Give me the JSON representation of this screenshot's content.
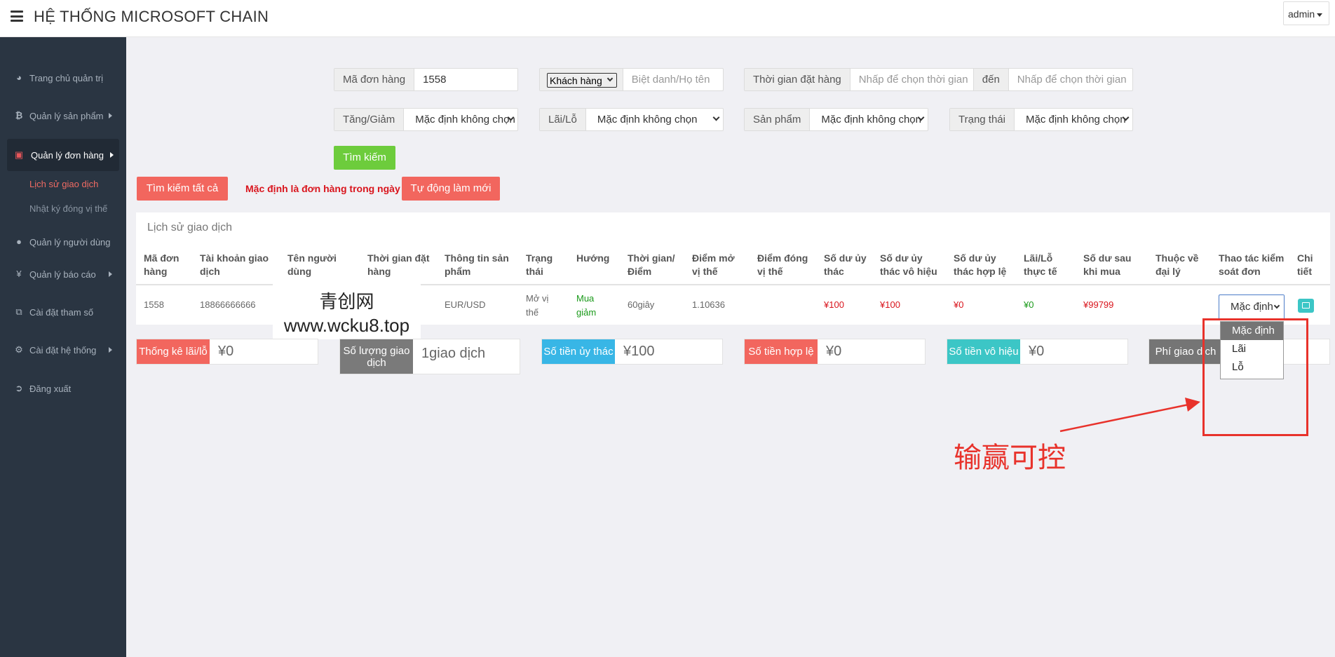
{
  "header": {
    "title": "HỆ THỐNG MICROSOFT CHAIN",
    "user": "admin"
  },
  "sidebar": {
    "items": [
      {
        "label": "Trang chủ quản trị",
        "icon": "dashboard-icon"
      },
      {
        "label": "Quản lý sản phẩm",
        "icon": "bitcoin-icon"
      },
      {
        "label": "Quản lý đơn hàng",
        "icon": "orders-icon"
      },
      {
        "label": "Quản lý người dùng",
        "icon": "user-icon"
      },
      {
        "label": "Quản lý báo cáo",
        "icon": "yen-icon"
      },
      {
        "label": "Cài đặt tham số",
        "icon": "copy-icon"
      },
      {
        "label": "Cài đặt hệ thống",
        "icon": "gears-icon"
      },
      {
        "label": "Đăng xuất",
        "icon": "logout-icon"
      }
    ],
    "sub_items": [
      {
        "label": "Lịch sử giao dịch"
      },
      {
        "label": "Nhật ký đóng vị thế"
      }
    ]
  },
  "filters": {
    "order_id": {
      "label": "Mã đơn hàng",
      "value": "1558"
    },
    "customer": {
      "select": "Khách hàng",
      "placeholder": "Biệt danh/Họ tên"
    },
    "order_time": {
      "label": "Thời gian đặt hàng",
      "placeholder_from": "Nhấp để chọn thời gian",
      "to_label": "đến",
      "placeholder_to": "Nhấp để chọn thời gian"
    },
    "direction": {
      "label": "Tăng/Giảm",
      "value": "Mặc định không chọn"
    },
    "profit": {
      "label": "Lãi/Lỗ",
      "value": "Mặc định không chọn"
    },
    "product": {
      "label": "Sản phẩm",
      "value": "Mặc định không chọn"
    },
    "status": {
      "label": "Trạng thái",
      "value": "Mặc định không chọn"
    },
    "search_button": "Tìm kiếm"
  },
  "actions": {
    "search_all": "Tìm kiếm tất cả",
    "default_note": "Mặc định là đơn hàng trong ngày",
    "auto_refresh": "Tự động làm mới"
  },
  "table": {
    "title": "Lịch sử giao dịch",
    "columns": [
      "Mã đơn hàng",
      "Tài khoản giao dịch",
      "Tên người dùng",
      "Thời gian đặt hàng",
      "Thông tin sản phẩm",
      "Trạng thái",
      "Hướng",
      "Thời gian/ Điểm",
      "Điểm mở vị thế",
      "Điểm đóng vị thế",
      "Số dư ủy thác",
      "Số dư ủy thác vô hiệu",
      "Số dư ủy thác hợp lệ",
      "Lãi/Lỗ thực tế",
      "Số dư sau khi mua",
      "Thuộc về đại lý",
      "Thao tác kiểm soát đơn",
      "Chi tiết"
    ],
    "row": {
      "order_id": "1558",
      "account": "18866666666",
      "product": "EUR/USD",
      "status": "Mở vị thế",
      "direction": "Mua giảm",
      "time_point": "60giây",
      "open_point": "1.10636",
      "entrusted": "¥100",
      "invalid": "¥100",
      "valid": "¥0",
      "profit": "¥0",
      "balance_after": "¥99799",
      "control_value": "Mặc định"
    }
  },
  "watermark": {
    "line1": "青创网",
    "line2": "www.wcku8.top"
  },
  "stats": [
    {
      "label": "Thống kê lãi/lỗ",
      "value": "¥0",
      "color": "#f2665e"
    },
    {
      "label": "Số lượng giao dịch",
      "value": "1giao dịch",
      "color": "#7a7a7a"
    },
    {
      "label": "Số tiền ủy thác",
      "value": "¥100",
      "color": "#38b6e6"
    },
    {
      "label": "Số tiền hợp lệ",
      "value": "¥0",
      "color": "#f2665e"
    },
    {
      "label": "Số tiền vô hiệu",
      "value": "¥0",
      "color": "#3cc6c6"
    },
    {
      "label": "Phí giao dịch",
      "value": "",
      "color": "#757575"
    }
  ],
  "dropdown": {
    "options": [
      "Mặc định",
      "Lãi",
      "Lỗ"
    ],
    "selected": "Mặc định"
  },
  "annotation": {
    "text": "输赢可控",
    "color": "#e8322b"
  }
}
